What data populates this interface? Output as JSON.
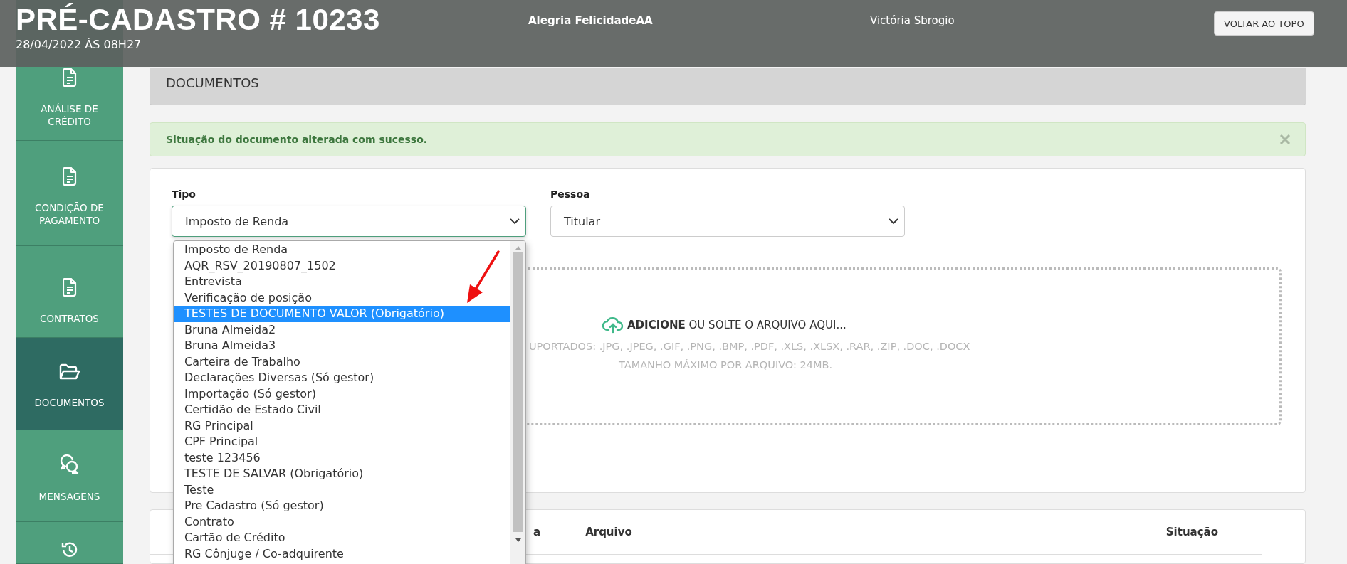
{
  "header": {
    "title": "PRÉ-CADASTRO # 10233",
    "date": "28/04/2022 ÀS 08H27",
    "client": "Alegria FelicidadeAA",
    "agent": "Victória Sbrogio",
    "back_to_top": "VOLTAR AO TOPO"
  },
  "sidebar": {
    "items": [
      {
        "label": "ANÁLISE DE CRÉDITO",
        "kind": "document",
        "selected": false
      },
      {
        "label": "CONDIÇÃO DE PAGAMENTO",
        "kind": "document",
        "selected": false
      },
      {
        "label": "CONTRATOS",
        "kind": "document",
        "selected": false
      },
      {
        "label": "DOCUMENTOS",
        "kind": "folder",
        "selected": true
      },
      {
        "label": "MENSAGENS",
        "kind": "chat",
        "selected": false
      },
      {
        "kind": "history",
        "selected": false
      }
    ]
  },
  "section_title": "DOCUMENTOS",
  "alert": {
    "message": "Situação do documento alterada com sucesso."
  },
  "form": {
    "fields": [
      {
        "label": "Tipo",
        "value": "Imposto de Renda",
        "focused": true
      },
      {
        "label": "Pessoa",
        "value": "Titular",
        "focused": false
      }
    ]
  },
  "dropdown": {
    "options": [
      {
        "label": "Imposto de Renda",
        "selected": false
      },
      {
        "label": "AQR_RSV_20190807_1502",
        "selected": false
      },
      {
        "label": "Entrevista",
        "selected": false
      },
      {
        "label": "Verificação de posição",
        "selected": false
      },
      {
        "label": "TESTES DE DOCUMENTO VALOR (Obrigatório)",
        "selected": true
      },
      {
        "label": "Bruna Almeida2",
        "selected": false
      },
      {
        "label": "Bruna Almeida3",
        "selected": false
      },
      {
        "label": "Carteira de Trabalho",
        "selected": false
      },
      {
        "label": "Declarações Diversas (Só gestor)",
        "selected": false
      },
      {
        "label": "Importação (Só gestor)",
        "selected": false
      },
      {
        "label": "Certidão de Estado Civil",
        "selected": false
      },
      {
        "label": "RG Principal",
        "selected": false
      },
      {
        "label": "CPF Principal",
        "selected": false
      },
      {
        "label": "teste 123456",
        "selected": false
      },
      {
        "label": "TESTE DE SALVAR (Obrigatório)",
        "selected": false
      },
      {
        "label": "Teste",
        "selected": false
      },
      {
        "label": "Pre Cadastro (Só gestor)",
        "selected": false
      },
      {
        "label": "Contrato",
        "selected": false
      },
      {
        "label": "Cartão de Crédito",
        "selected": false
      },
      {
        "label": "RG Cônjuge / Co-adquirente",
        "selected": false
      }
    ]
  },
  "dropzone": {
    "prompt": "**ADICIONE** OU SOLTE O ARQUIVO AQUI...",
    "formats": "UPORTADOS: .JPG, .JPEG, .GIF, .PNG, .BMP, .PDF, .XLS, .XLSX, .RAR, .ZIP, .DOC, .DOCX",
    "max_size": "TAMANHO MÁXIMO POR ARQUIVO: 24MB."
  },
  "table": {
    "columns": [
      "a",
      "Arquivo",
      "Situação"
    ]
  }
}
